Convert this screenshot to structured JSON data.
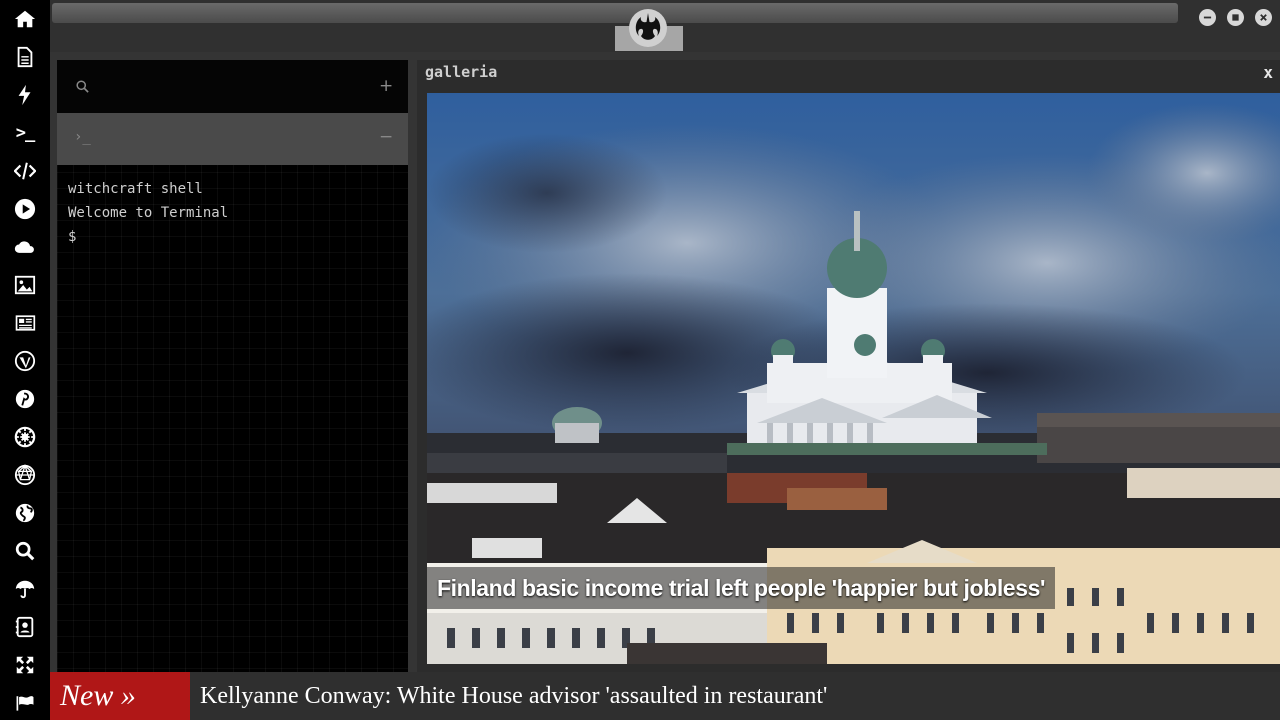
{
  "rail": {
    "icons": [
      "home-icon",
      "document-icon",
      "bolt-icon",
      "terminal-icon",
      "code-icon",
      "play-icon",
      "cloud-icon",
      "image-icon",
      "newspaper-icon",
      "wordpress-icon",
      "pinterest-icon",
      "galactic-empire-icon",
      "geodesic-sphere-icon",
      "globe-icon",
      "search-icon",
      "umbrella-icon",
      "contacts-icon",
      "expand-icon",
      "flag-icon"
    ]
  },
  "topbar": {
    "logo_icon": "rebel-alliance-icon",
    "window_controls": [
      "minimize-icon",
      "maximize-icon",
      "close-icon"
    ]
  },
  "terminal": {
    "search_icon": "search-icon",
    "add_symbol": "+",
    "tab_prompt": "›_",
    "collapse_symbol": "−",
    "lines": [
      "witchcraft shell",
      "Welcome to Terminal",
      "$"
    ]
  },
  "gallery": {
    "title": "galleria",
    "close_label": "x",
    "caption": "Finland basic income trial left people 'happier but jobless'"
  },
  "ticker": {
    "label": "New »",
    "headline": "Kellyanne Conway: White House advisor 'assaulted in restaurant'"
  },
  "colors": {
    "rail_bg": "#000000",
    "panel_bg": "#343434",
    "ticker_label_bg": "#b01717",
    "terminal_bg": "#000000"
  }
}
